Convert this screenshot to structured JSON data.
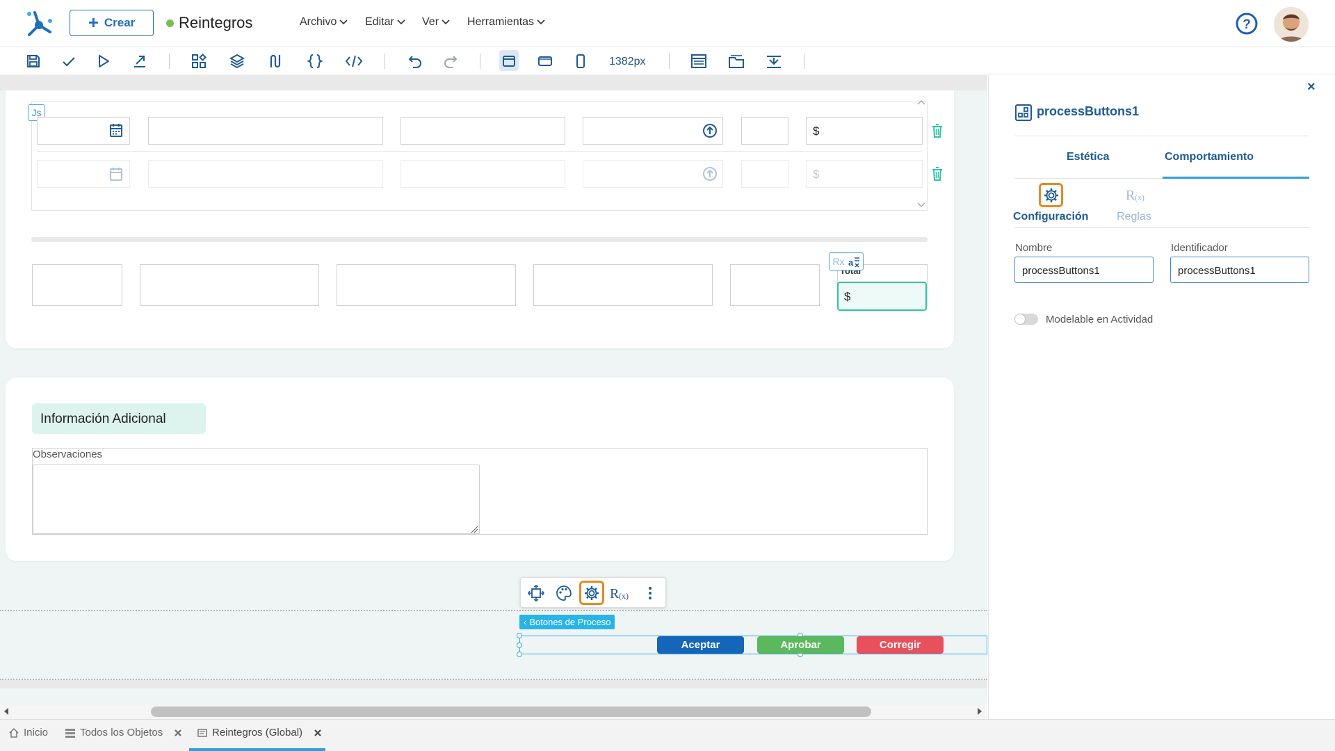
{
  "header": {
    "create_label": "Crear",
    "app_title": "Reintegros",
    "status_color": "#7bbd55",
    "menu": [
      {
        "label": "Archivo"
      },
      {
        "label": "Editar"
      },
      {
        "label": "Ver"
      },
      {
        "label": "Herramientas"
      }
    ]
  },
  "toolbar": {
    "width_readout": "1382px"
  },
  "canvas": {
    "js_badge": "Js",
    "currency": "$",
    "rx_badge": "Rx",
    "total_label": "Total",
    "info_section": {
      "title": "Información Adicional",
      "observations_label": "Observaciones"
    },
    "process_buttons": {
      "tag_label": "Botones de Proceso",
      "buttons": [
        {
          "label": "Aceptar",
          "color": "#1565b8"
        },
        {
          "label": "Aprobar",
          "color": "#5cb85c"
        },
        {
          "label": "Corregir",
          "color": "#e8505b"
        }
      ]
    }
  },
  "panel": {
    "title": "processButtons1",
    "tabs": [
      {
        "label": "Estética"
      },
      {
        "label": "Comportamiento"
      }
    ],
    "subtabs": [
      {
        "label": "Configuración"
      },
      {
        "label": "Reglas"
      }
    ],
    "fields": {
      "name_label": "Nombre",
      "name_value": "processButtons1",
      "id_label": "Identificador",
      "id_value": "processButtons1"
    },
    "toggle_label": "Modelable en Actividad",
    "close_glyph": "×"
  },
  "bottom_tabs": [
    {
      "label": "Inicio"
    },
    {
      "label": "Todos los Objetos"
    },
    {
      "label": "Reintegros (Global)"
    }
  ],
  "colors": {
    "accent": "#1f6fbf",
    "highlight": "#e78a25",
    "teal": "#2ec4a6"
  }
}
